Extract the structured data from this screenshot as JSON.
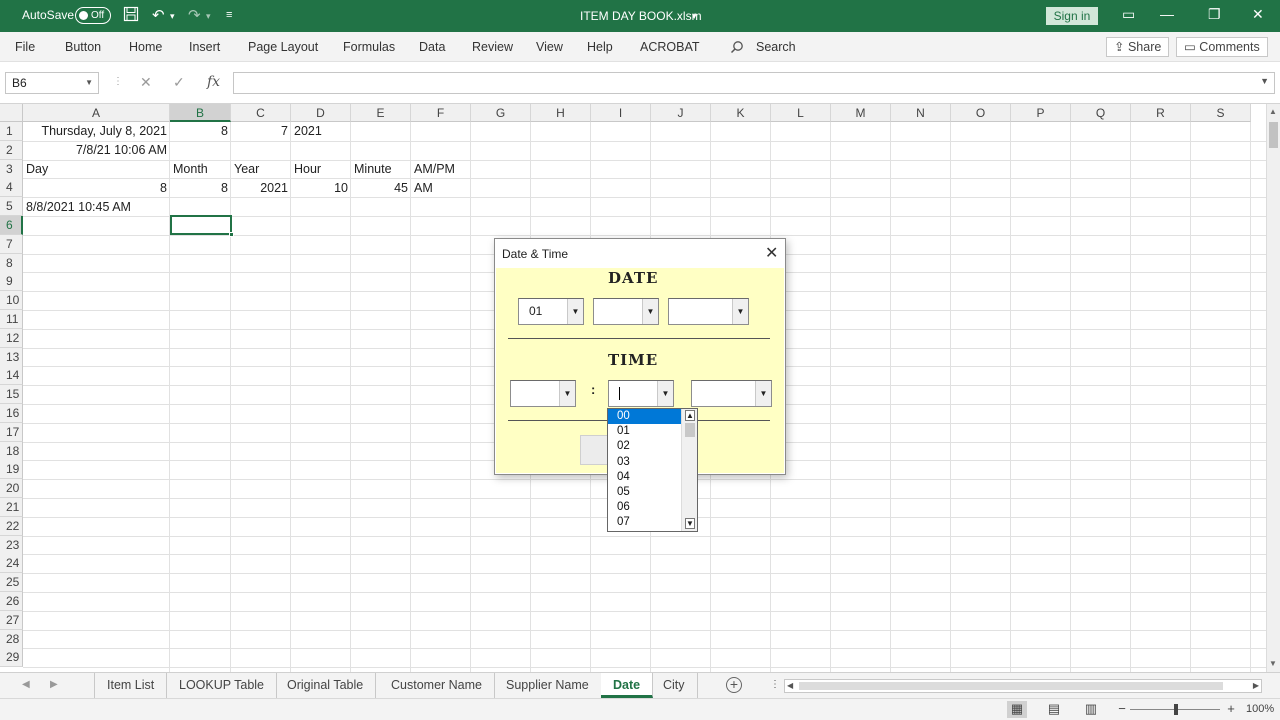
{
  "titlebar": {
    "autosave_label": "AutoSave",
    "autosave_state": "Off",
    "filename": "ITEM DAY BOOK.xlsm",
    "signin_label": "Sign in"
  },
  "ribbon": {
    "tabs": [
      "File",
      "Button",
      "Home",
      "Insert",
      "Page Layout",
      "Formulas",
      "Data",
      "Review",
      "View",
      "Help",
      "ACROBAT"
    ],
    "search_label": "Search",
    "share_label": "Share",
    "comments_label": "Comments"
  },
  "formula_bar": {
    "name_box": "B6",
    "fx_label": "fx",
    "content": ""
  },
  "grid": {
    "columns": [
      "A",
      "B",
      "C",
      "D",
      "E",
      "F",
      "G",
      "H",
      "I",
      "J",
      "K",
      "L",
      "M",
      "N",
      "O",
      "P",
      "Q",
      "R",
      "S"
    ],
    "rows": [
      "1",
      "2",
      "3",
      "4",
      "5",
      "6",
      "7",
      "8",
      "9",
      "10",
      "11",
      "12",
      "13",
      "14",
      "15",
      "16",
      "17",
      "18",
      "19",
      "20",
      "21",
      "22",
      "23",
      "24",
      "25",
      "26",
      "27",
      "28",
      "29"
    ],
    "selected_column": "B",
    "selected_row": "6",
    "cells": {
      "A1": "Thursday, July 8, 2021",
      "B1": "8",
      "C1": "7",
      "D1": "2021",
      "A2": "7/8/21 10:06 AM",
      "A3": "Day",
      "B3": "Month",
      "C3": "Year",
      "D3": "Hour",
      "E3": "Minute",
      "F3": "AM/PM",
      "A4": "8",
      "B4": "8",
      "C4": "2021",
      "D4": "10",
      "E4": "45",
      "F4": "AM",
      "A5": "8/8/2021 10:45 AM"
    }
  },
  "sheet_tabs": [
    "Item List",
    "LOOKUP Table",
    "Original Table",
    "Customer Name",
    "Supplier Name",
    "Date",
    "City"
  ],
  "active_sheet": "Date",
  "statusbar": {
    "zoom": "100%"
  },
  "dialog": {
    "title": "Date & Time",
    "date_heading": "DATE",
    "time_heading": "TIME",
    "colon": ":",
    "date_day_value": "01",
    "date_month_value": "",
    "date_year_value": "",
    "time_hour_value": "",
    "time_minute_value": "",
    "time_ampm_value": "",
    "minute_dropdown": {
      "items": [
        "00",
        "01",
        "02",
        "03",
        "04",
        "05",
        "06",
        "07"
      ],
      "highlighted": "00"
    }
  }
}
